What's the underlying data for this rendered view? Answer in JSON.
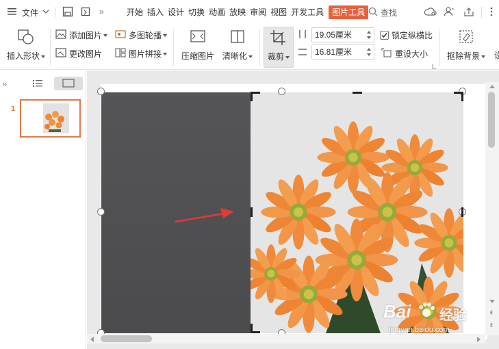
{
  "menubar": {
    "file_label": "文件",
    "tabs": [
      "开始",
      "插入",
      "设计",
      "切换",
      "动画",
      "放映",
      "审阅",
      "视图",
      "开发工具"
    ],
    "active_tab": "图片工具",
    "search_label": "查找"
  },
  "toolbar": {
    "insert_shape": "插入形状",
    "add_picture": "添加图片",
    "multi_carousel": "多图轮播",
    "change_picture": "更改图片",
    "picture_collage": "图片拼接",
    "compress_picture": "压缩图片",
    "sharpen": "清晰化",
    "crop": "裁剪",
    "height_value": "19.05厘米",
    "width_value": "16.81厘米",
    "lock_ratio": "锁定纵横比",
    "reset_size": "重设大小",
    "remove_background": "抠除背景",
    "truncated": "设"
  },
  "slides_panel": {
    "slide_number": "1"
  },
  "watermark": {
    "brand": "Bai",
    "brand_cn": "经验",
    "url": "jingyan.baidu.com"
  },
  "colors": {
    "accent": "#e8613a",
    "dark_panel": "#4e4e51",
    "arrow": "#e03a3a"
  }
}
